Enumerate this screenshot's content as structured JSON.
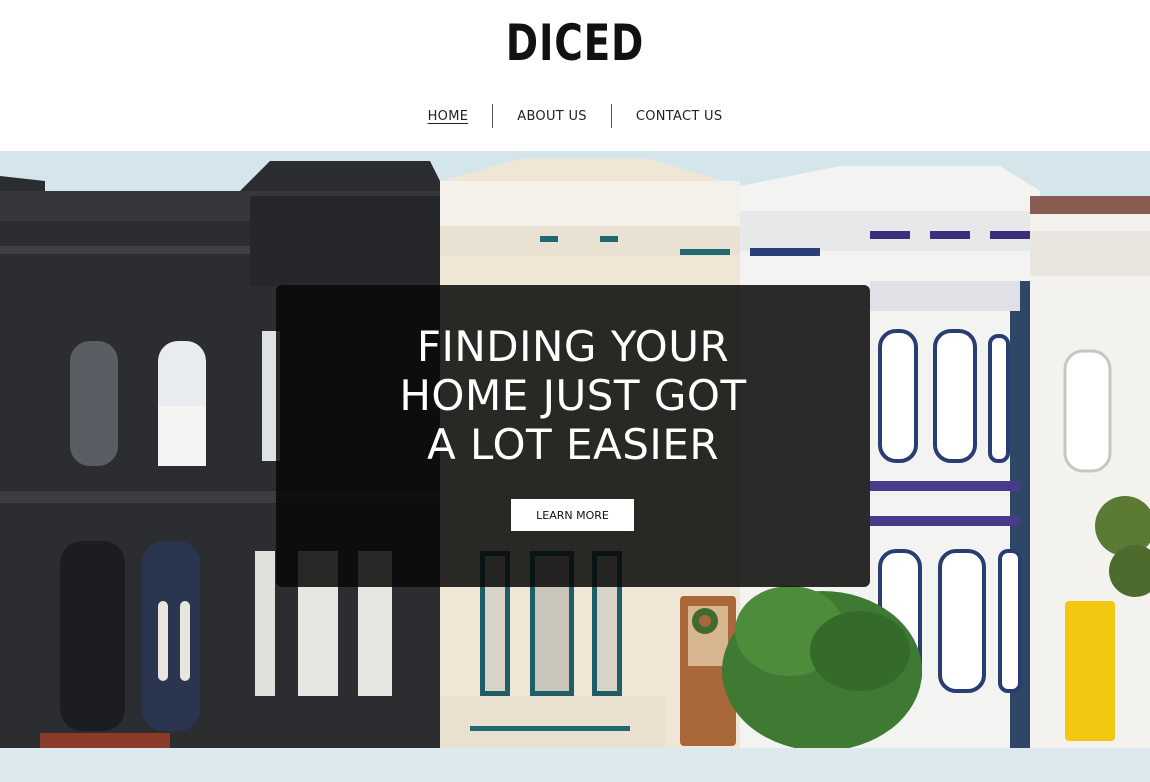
{
  "site": {
    "logo_text": "DICED"
  },
  "nav": {
    "items": [
      {
        "label": "HOME",
        "active": true
      },
      {
        "label": "ABOUT US",
        "active": false
      },
      {
        "label": "CONTACT US",
        "active": false
      }
    ]
  },
  "hero": {
    "headline_line1": "FINDING YOUR",
    "headline_line2": "HOME JUST GOT",
    "headline_line3": "A LOT EASIER",
    "cta_label": "LEARN MORE"
  },
  "colors": {
    "overlay": "#080808",
    "cta_background": "#ffffff",
    "text_dark": "#111111",
    "text_light": "#ffffff"
  }
}
